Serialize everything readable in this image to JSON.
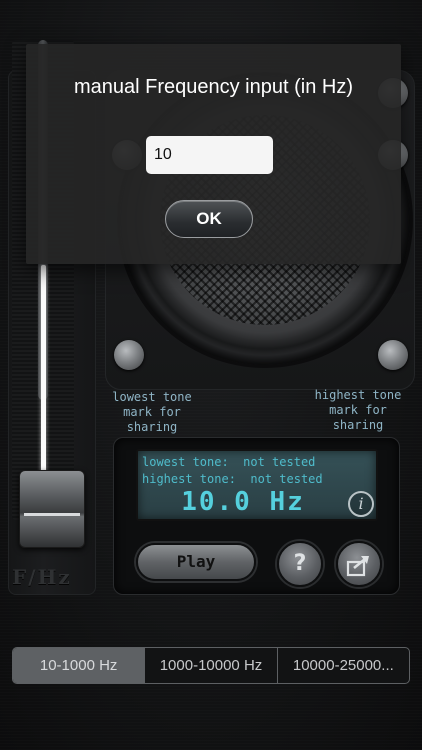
{
  "dialog": {
    "title": "manual Frequency input (in Hz)",
    "input_value": "10",
    "ok_label": "OK"
  },
  "slider": {
    "caption": "F/Hz",
    "level_fraction": 0.03
  },
  "speaker": {
    "left_screw_label": "lowest tone\nmark for\nsharing",
    "right_screw_label": "highest tone\nmark for\nsharing"
  },
  "display": {
    "lowest_line": "lowest tone:  not tested",
    "highest_line": "highest tone:  not tested",
    "value": "10.0 Hz",
    "info_glyph": "i"
  },
  "controls": {
    "play_label": "Play",
    "help_glyph": "?",
    "share_icon": "share-icon"
  },
  "ranges": {
    "options": [
      "10-1000 Hz",
      "1000-10000 Hz",
      "10000-25000..."
    ],
    "selected": "10-1000 Hz"
  },
  "colors": {
    "lcd_text": "#4fbccb",
    "label_text": "#8fb5c6",
    "dialog_bg": "#262626"
  }
}
